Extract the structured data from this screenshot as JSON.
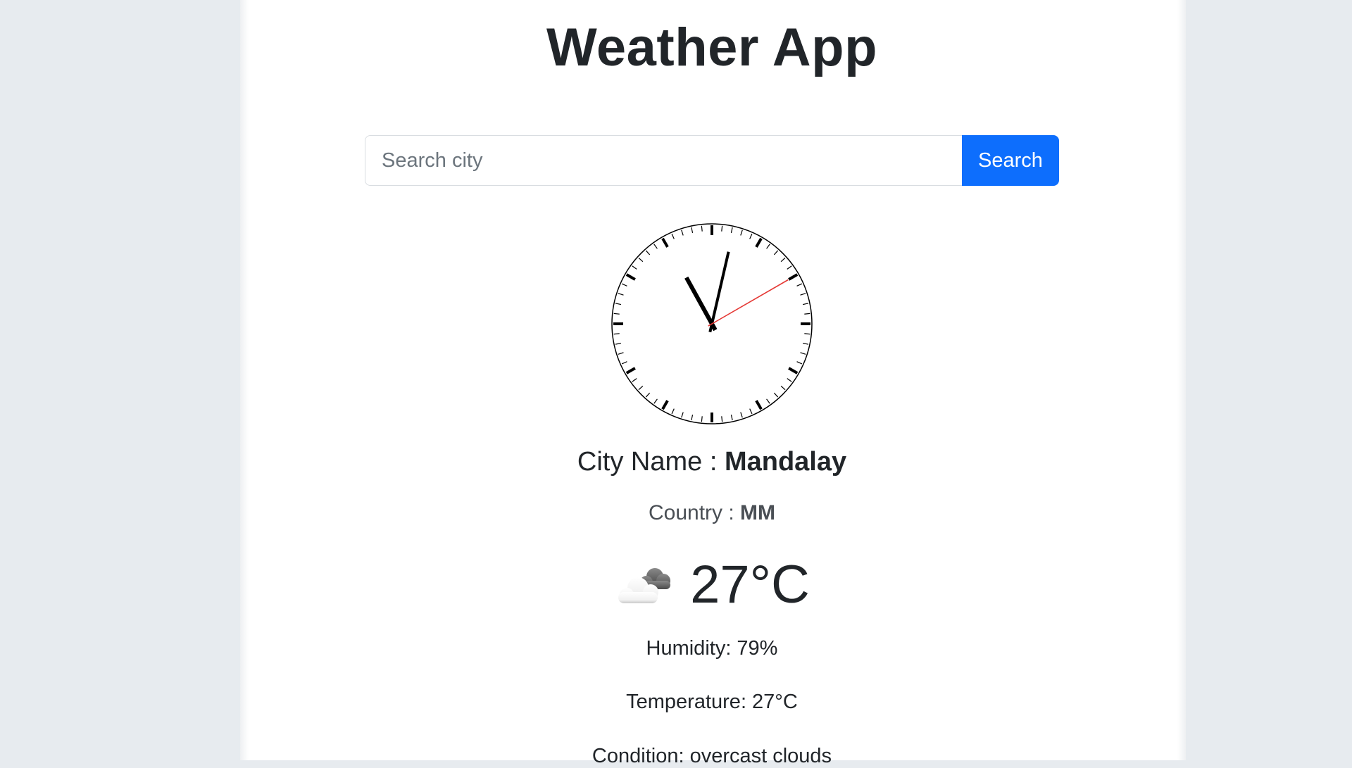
{
  "app": {
    "title": "Weather App"
  },
  "search": {
    "placeholder": "Search city",
    "value": "",
    "button_label": "Search"
  },
  "clock": {
    "hour": 11,
    "minute": 2,
    "second": 10,
    "hand_color": "#000000",
    "second_hand_color": "#e53935"
  },
  "weather": {
    "city_label": "City Name : ",
    "city_value": "Mandalay",
    "country_label": "Country : ",
    "country_value": "MM",
    "icon": "overcast-clouds-icon",
    "temperature_display": "27°C",
    "humidity": "Humidity: 79%",
    "temperature": "Temperature: 27°C",
    "condition": "Condition: overcast clouds"
  },
  "colors": {
    "accent": "#0d6efd",
    "page_background": "#e7ebef",
    "card_background": "#ffffff"
  }
}
